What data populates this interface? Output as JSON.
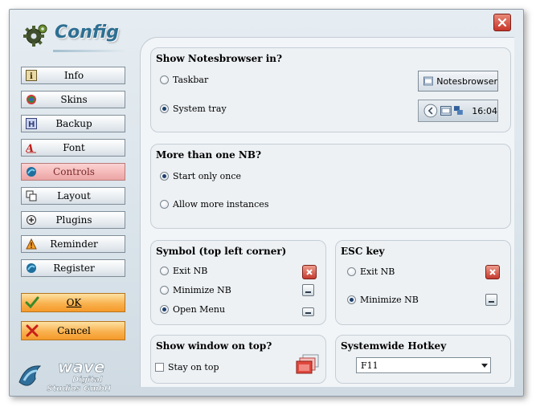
{
  "app": {
    "title": "Config"
  },
  "sidebar": {
    "items": [
      {
        "label": "Info",
        "icon": "info-icon"
      },
      {
        "label": "Skins",
        "icon": "skins-icon"
      },
      {
        "label": "Backup",
        "icon": "backup-icon"
      },
      {
        "label": "Font",
        "icon": "font-icon"
      },
      {
        "label": "Controls",
        "icon": "controls-icon",
        "active": true
      },
      {
        "label": "Layout",
        "icon": "layout-icon"
      },
      {
        "label": "Plugins",
        "icon": "plugins-icon"
      },
      {
        "label": "Reminder",
        "icon": "reminder-icon"
      },
      {
        "label": "Register",
        "icon": "register-icon"
      }
    ],
    "ok_label": "OK",
    "cancel_label": "Cancel"
  },
  "company": {
    "line1": "wave",
    "line2": "Digital",
    "line3": "Studios GmbH"
  },
  "show_in": {
    "title": "Show Notesbrowser in?",
    "options": [
      "Taskbar",
      "System tray"
    ],
    "selected": "System tray",
    "taskbar_preview_label": "Notesbrowser",
    "tray_time": "16:04"
  },
  "more_than_one": {
    "title": "More than one NB?",
    "options": [
      "Start only once",
      "Allow more instances"
    ],
    "selected": "Start only once"
  },
  "symbol": {
    "title": "Symbol (top left corner)",
    "options": [
      "Exit NB",
      "Minimize NB",
      "Open Menu"
    ],
    "selected": "Open Menu"
  },
  "esc": {
    "title": "ESC key",
    "options": [
      "Exit NB",
      "Minimize NB"
    ],
    "selected": "Minimize NB"
  },
  "on_top": {
    "title": "Show window on top?",
    "checkbox_label": "Stay on top",
    "checked": false
  },
  "hotkey": {
    "title": "Systemwide Hotkey",
    "value": "F11"
  },
  "colors": {
    "accent_title": "#2e6f92",
    "active_nav": "#f4b6b6",
    "action_buttons": "#f9b14f",
    "close_red": "#c8352a"
  }
}
